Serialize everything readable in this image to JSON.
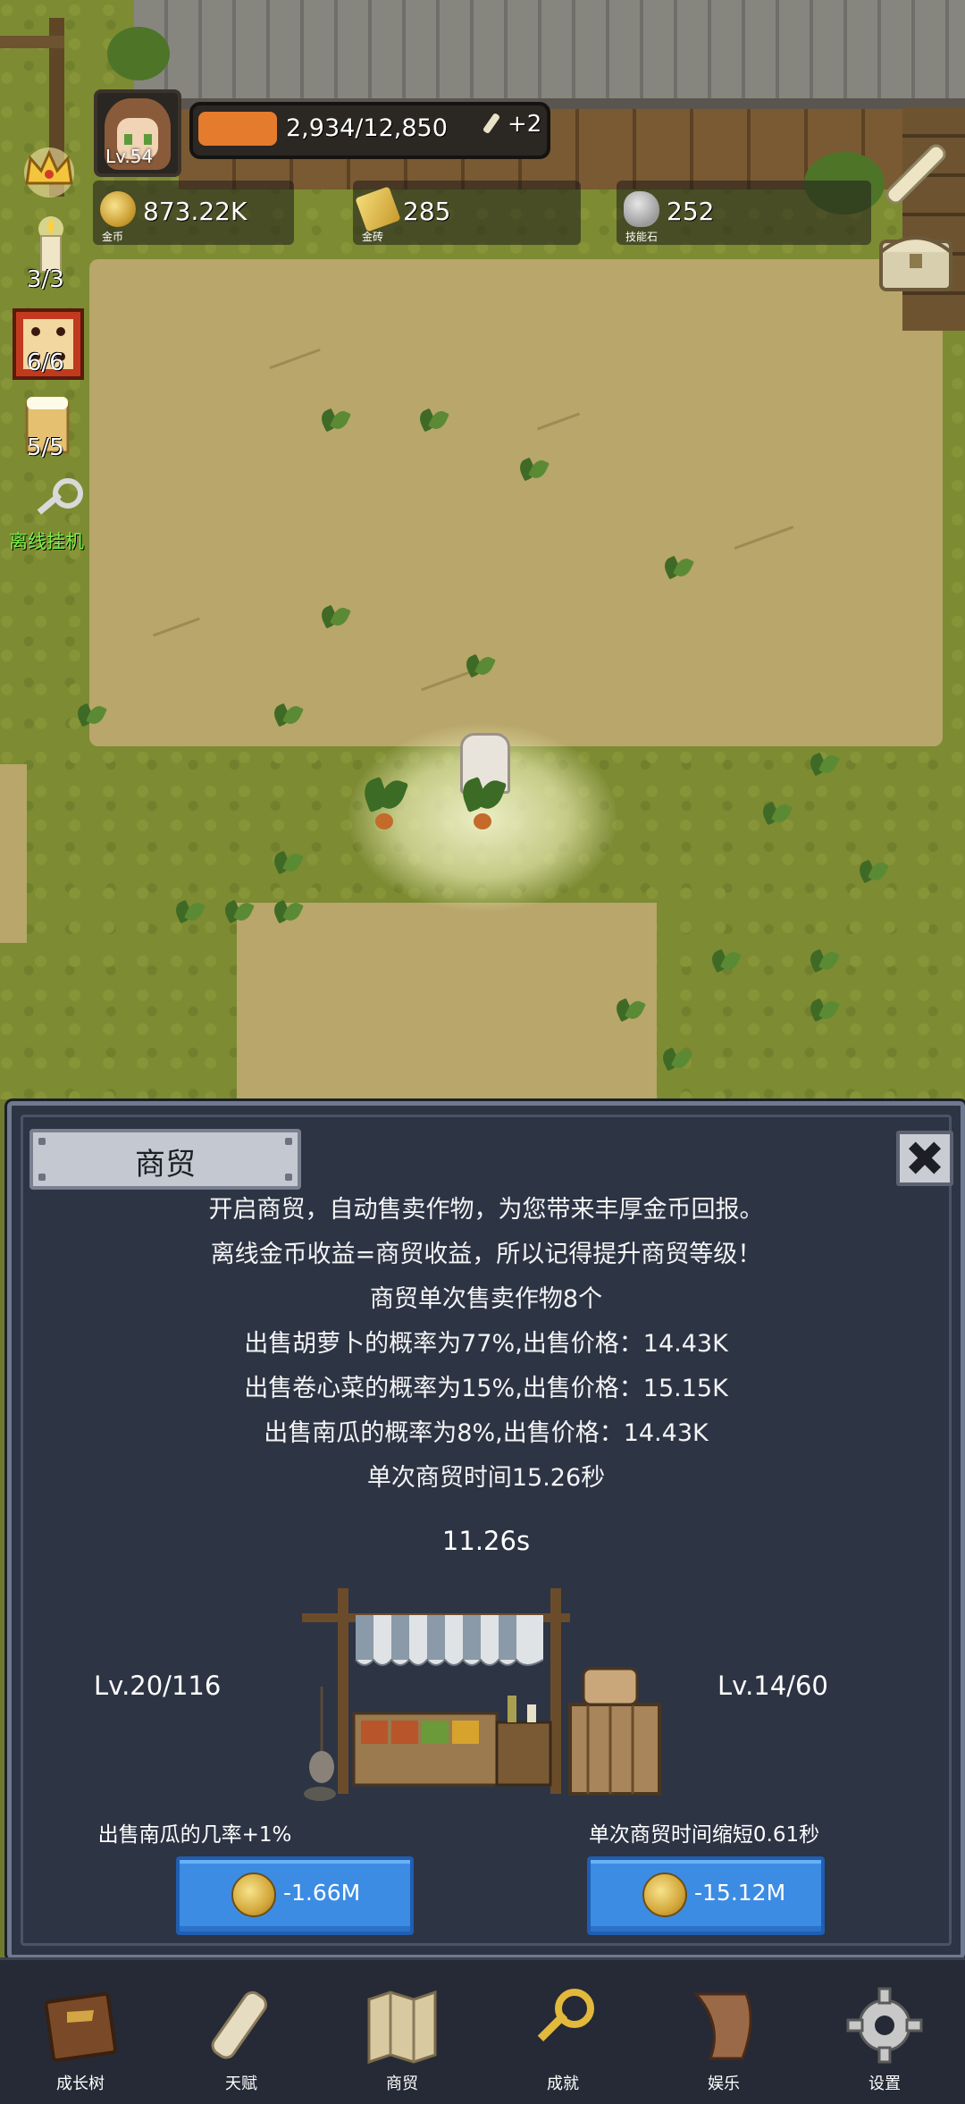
{
  "hud": {
    "level": "Lv.54",
    "xp_text": "2,934/12,850",
    "xp_progress": 0.23,
    "xp_bonus": "+2",
    "resources": [
      {
        "icon": "gold-coin-icon",
        "value": "873.22K",
        "label": "金币"
      },
      {
        "icon": "gold-brick-icon",
        "value": "285",
        "label": "金砖"
      },
      {
        "icon": "skill-stone-icon",
        "value": "252",
        "label": "技能石"
      }
    ]
  },
  "left_tools": {
    "candle_count": "3/3",
    "dice_count": "6/6",
    "beer_count": "5/5",
    "offline_label": "离线挂机"
  },
  "dialog": {
    "title": "商贸",
    "lines": [
      "开启商贸，自动售卖作物，为您带来丰厚金币回报。",
      "离线金币收益=商贸收益，所以记得提升商贸等级！",
      "商贸单次售卖作物8个",
      "出售胡萝卜的概率为77%,出售价格：14.43K",
      "出售卷心菜的概率为15%,出售价格：15.15K",
      "出售南瓜的概率为8%,出售价格：14.43K",
      "单次商贸时间15.26秒"
    ],
    "timer": "11.26s",
    "left_level": "Lv.20/116",
    "right_level": "Lv.14/60",
    "left_upgrade": "出售南瓜的几率+1%",
    "right_upgrade": "单次商贸时间缩短0.61秒",
    "left_cost": "-1.66M",
    "right_cost": "-15.12M"
  },
  "nav": [
    {
      "label": "成长树",
      "icon": "book-icon"
    },
    {
      "label": "天赋",
      "icon": "scroll-icon"
    },
    {
      "label": "商贸",
      "icon": "map-icon"
    },
    {
      "label": "成就",
      "icon": "key-icon"
    },
    {
      "label": "娱乐",
      "icon": "paper-icon"
    },
    {
      "label": "设置",
      "icon": "gear-icon"
    }
  ],
  "colors": {
    "button_blue": "#3d8ce4",
    "panel_bg": "#2d3444",
    "xp_orange": "#e57b2c",
    "offline_green": "#7cf04a"
  }
}
